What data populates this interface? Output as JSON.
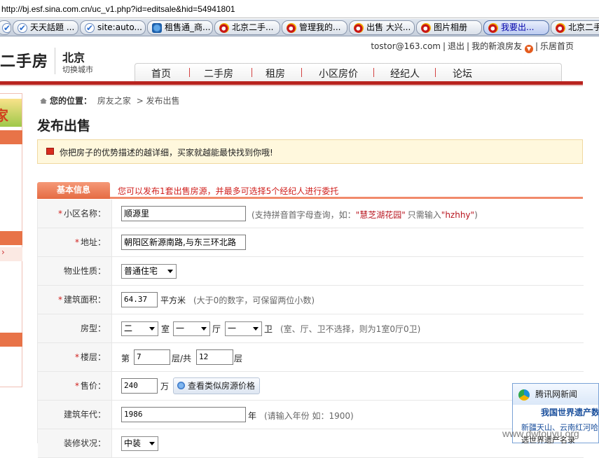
{
  "browser": {
    "url": "http://bj.esf.sina.com.cn/uc_v1.php?id=editsale&hid=54941801",
    "tabs": [
      {
        "label": "",
        "icon": "check-icon"
      },
      {
        "label": "天天話題 ...",
        "icon": "check-icon"
      },
      {
        "label": "site:auto...",
        "icon": "check-icon"
      },
      {
        "label": "租售通_商...",
        "icon": "tool-icon"
      },
      {
        "label": "北京二手...",
        "icon": "sina-icon"
      },
      {
        "label": "管理我的...",
        "icon": "sina-icon"
      },
      {
        "label": "出售 大兴...",
        "icon": "sina-icon"
      },
      {
        "label": "图片相册",
        "icon": "sina-icon"
      },
      {
        "label": "我要出...",
        "icon": "sina-icon",
        "active": true
      },
      {
        "label": "北京二手...",
        "icon": "sina-icon"
      }
    ]
  },
  "header": {
    "brand": "二手房",
    "city": "北京",
    "city_switch": "切换城市",
    "user_email": "tostor@163.com",
    "logout": "退出",
    "my_sina": "我的新浪房友",
    "lejv_home": "乐居首页",
    "nav": [
      "首页",
      "二手房",
      "租房",
      "小区房价",
      "经纪人",
      "论坛"
    ]
  },
  "sidebar": {
    "banner_text": "家",
    "selected_arrow": "›"
  },
  "breadcrumb": {
    "label": "您的位置：",
    "items": [
      "房友之家",
      "> 发布出售"
    ]
  },
  "page_title": "发布出售",
  "tip": "你把房子的优势描述的越详细，买家就越能最快找到你哦!",
  "section": {
    "badge": "基本信息",
    "note": "您可以发布1套出售房源，并最多可选择5个经纪人进行委托"
  },
  "form": {
    "community": {
      "label": "小区名称：",
      "value": "顺源里",
      "hint_pre": "(支持拼音首字母查询，如：",
      "hint_example": "慧芝湖花园",
      "hint_mid": "只需输入",
      "hint_code": "hzhhy",
      "hint_post": ")"
    },
    "address": {
      "label": "地址：",
      "value": "朝阳区新源南路,与东三环北路"
    },
    "property_type": {
      "label": "物业性质：",
      "value": "普通住宅"
    },
    "area": {
      "label": "建筑面积：",
      "value": "64.37",
      "unit": "平方米",
      "hint": "(大于0的数字，可保留两位小数)"
    },
    "layout": {
      "label": "房型：",
      "rooms": "二",
      "rooms_unit": "室",
      "halls": "一",
      "halls_unit": "厅",
      "baths": "一",
      "baths_unit": "卫",
      "hint": "(室、厅、卫不选择，则为1室0厅0卫)"
    },
    "floor": {
      "label": "楼层：",
      "prefix": "第",
      "value": "7",
      "mid": "层/共",
      "total": "12",
      "unit": "层"
    },
    "price": {
      "label": "售价：",
      "value": "240",
      "unit": "万",
      "compare_button": "查看类似房源价格"
    },
    "year": {
      "label": "建筑年代：",
      "value": "1986",
      "unit": "年",
      "hint": "(请输入年份 如：1900)"
    },
    "decoration": {
      "label": "装修状况：",
      "value": "中装"
    }
  },
  "popup": {
    "title": "腾讯网新闻",
    "headline": "我国世界遗产数",
    "line1": "新疆天山、云南红河哈",
    "line2": "选世界遗产名录"
  },
  "watermark": "www.dwtouyu.org"
}
